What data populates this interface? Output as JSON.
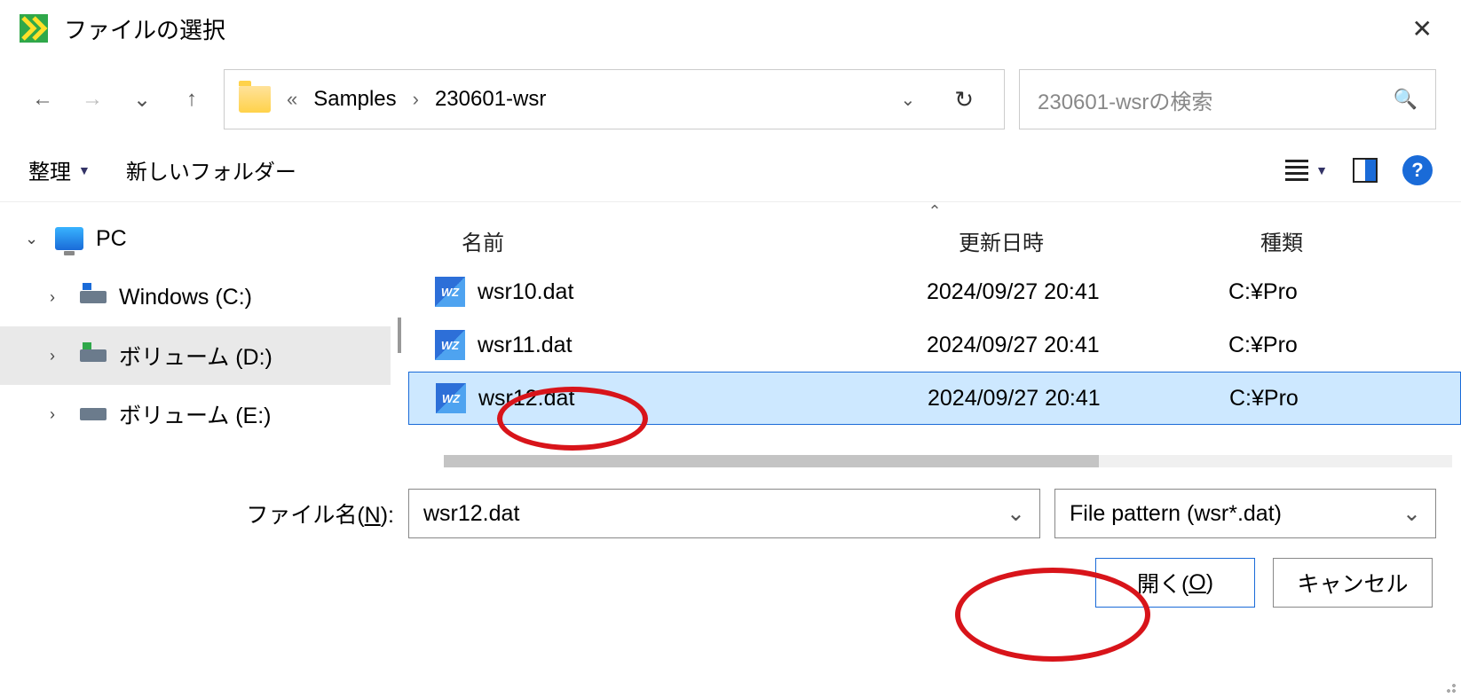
{
  "window": {
    "title": "ファイルの選択"
  },
  "breadcrumb": {
    "prefix": "«",
    "items": [
      "Samples",
      "230601-wsr"
    ]
  },
  "search": {
    "placeholder": "230601-wsrの検索"
  },
  "toolbar": {
    "organize": "整理",
    "new_folder": "新しいフォルダー"
  },
  "tree": {
    "root": "PC",
    "items": [
      {
        "label": "Windows (C:)"
      },
      {
        "label": "ボリューム (D:)",
        "selected": true
      },
      {
        "label": "ボリューム (E:)"
      }
    ]
  },
  "columns": {
    "name": "名前",
    "modified": "更新日時",
    "type": "種類"
  },
  "files": [
    {
      "name": "wsr10.dat",
      "modified": "2024/09/27 20:41",
      "type": "C:¥Pro",
      "selected": false
    },
    {
      "name": "wsr11.dat",
      "modified": "2024/09/27 20:41",
      "type": "C:¥Pro",
      "selected": false
    },
    {
      "name": "wsr12.dat",
      "modified": "2024/09/27 20:41",
      "type": "C:¥Pro",
      "selected": true
    }
  ],
  "filename": {
    "label_pre": "ファイル名(",
    "label_key": "N",
    "label_post": "):",
    "value": "wsr12.dat"
  },
  "filter": {
    "label": "File pattern (wsr*.dat)"
  },
  "buttons": {
    "open_pre": "開く(",
    "open_key": "O",
    "open_post": ")",
    "cancel": "キャンセル"
  },
  "icons": {
    "file_badge": "WZ"
  }
}
